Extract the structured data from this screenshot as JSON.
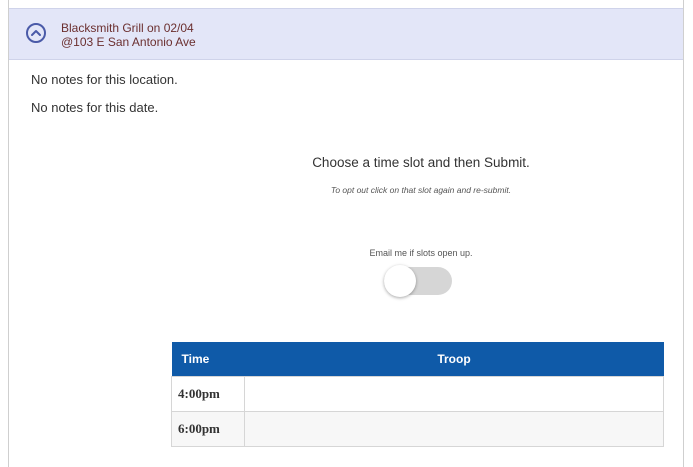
{
  "header": {
    "line1": "Blacksmith Grill on 02/04",
    "line2": "@103 E San Antonio Ave",
    "collapse_icon": "chevron-up-circle-icon"
  },
  "notes": {
    "location": "No notes for this location.",
    "date": "No notes for this date."
  },
  "instructions": {
    "title": "Choose a time slot and then Submit.",
    "subtitle": "To opt out click on that slot again and re-submit.",
    "email_label": "Email me if slots open up.",
    "email_toggle_on": false
  },
  "table": {
    "headers": {
      "time": "Time",
      "troop": "Troop"
    },
    "rows": [
      {
        "time": "4:00pm",
        "troop": ""
      },
      {
        "time": "6:00pm",
        "troop": ""
      }
    ]
  },
  "colors": {
    "header_bg": "#e3e6f8",
    "header_text": "#6b2f2f",
    "table_header_bg": "#0f5aa8",
    "toggle_off": "#d6d6d6"
  }
}
